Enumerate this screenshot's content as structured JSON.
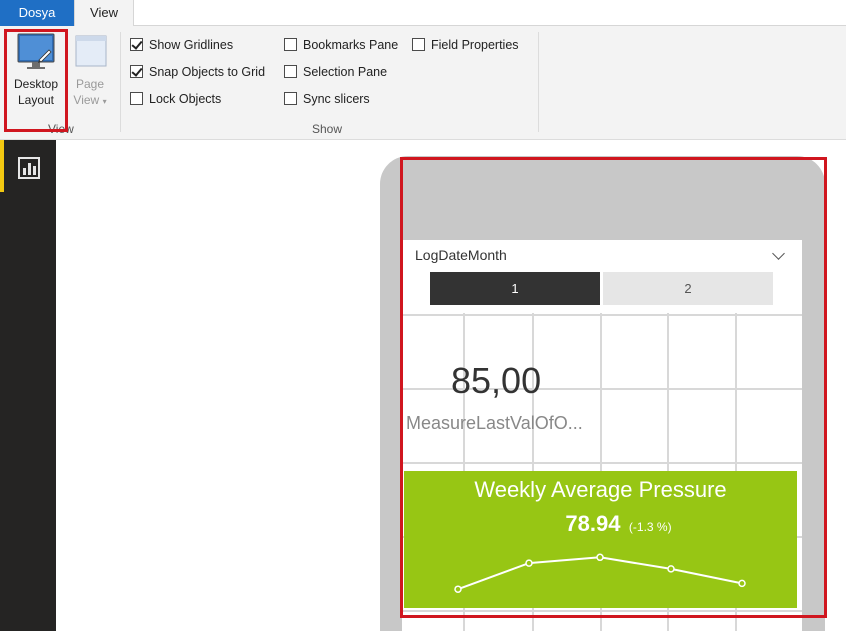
{
  "tabs": {
    "file": "Dosya",
    "view": "View"
  },
  "ribbon": {
    "view_group": {
      "label": "View",
      "desktop_layout": {
        "line1": "Desktop",
        "line2": "Layout"
      },
      "page_view": {
        "line1": "Page",
        "line2": "View"
      }
    },
    "show_group": {
      "label": "Show",
      "options": [
        {
          "label": "Show Gridlines",
          "checked": true
        },
        {
          "label": "Snap Objects to Grid",
          "checked": true
        },
        {
          "label": "Lock Objects",
          "checked": false
        },
        {
          "label": "Bookmarks Pane",
          "checked": false
        },
        {
          "label": "Selection Pane",
          "checked": false
        },
        {
          "label": "Sync slicers",
          "checked": false
        },
        {
          "label": "Field Properties",
          "checked": false
        }
      ]
    }
  },
  "rail": {
    "active_icon": "report-icon"
  },
  "phone_canvas": {
    "slicer": {
      "title": "LogDateMonth",
      "options": [
        "1",
        "2"
      ],
      "selected": "1"
    },
    "card": {
      "value": "85,00",
      "label": "MeasureLastValOfO..."
    },
    "kpi": {
      "title": "Weekly Average Pressure",
      "value": "78.94",
      "delta": "(-1.3 %)",
      "trend": [
        0.1,
        0.55,
        0.65,
        0.45,
        0.2
      ]
    }
  },
  "colors": {
    "file_tab": "#1f6fc5",
    "highlight": "#d0161f",
    "kpi_background": "#97c614",
    "rail": "#252423",
    "rail_accent": "#f2c811"
  }
}
